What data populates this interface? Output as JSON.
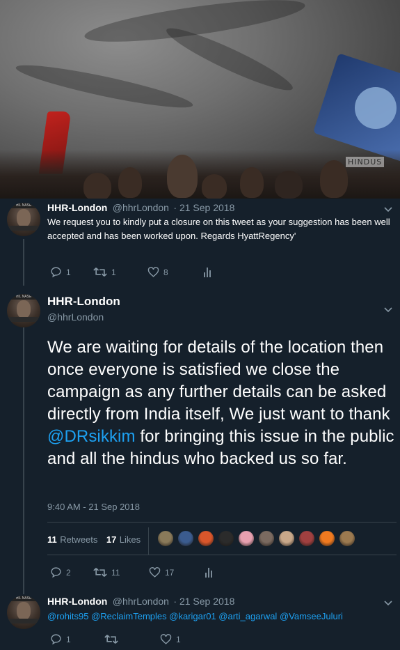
{
  "tweets": [
    {
      "name": "HHR-London",
      "handle": "@hhrLondon",
      "date": "· 21 Sep 2018",
      "text": "We request you to kindly put a closure on this tweet as your suggestion has been well accepted and has been worked upon.   Regards HyattRegency'",
      "replies": "1",
      "retweets": "1",
      "likes": "8"
    },
    {
      "name": "HHR-London",
      "handle": "@hhrLondon",
      "text_before": "We are waiting for details of the location then once everyone is satisfied we close the campaign as any further details can be asked directly from India itself, We just want to thank ",
      "mention": "@DRsikkim",
      "text_after": " for bringing this issue in the public and all the hindus who backed us so far.",
      "timestamp": "9:40 AM - 21 Sep 2018",
      "retweet_count": "11",
      "retweet_label": "Retweets",
      "like_count": "17",
      "like_label": "Likes",
      "replies": "2",
      "retweets": "11",
      "likes": "17",
      "liker_colors": [
        "#8a7a5a",
        "#3b5c8f",
        "#d9562b",
        "#2b2b2b",
        "#e7a0b0",
        "#7a6a60",
        "#c8a88a",
        "#a04040",
        "#f07a20",
        "#9c7a50"
      ]
    },
    {
      "name": "HHR-London",
      "handle": "@hhrLondon",
      "date": "· 21 Sep 2018",
      "mentions": [
        "@rohits95",
        "@ReclaimTemples",
        "@karigar01",
        "@arti_agarwal",
        "@VamseeJuluri"
      ],
      "replies": "1",
      "retweets": "",
      "likes": "1"
    }
  ],
  "banner": {
    "sign_text": "HINDUS"
  },
  "colors": {
    "background": "#15202b",
    "accent": "#1da1f2",
    "muted": "#8899a6"
  }
}
